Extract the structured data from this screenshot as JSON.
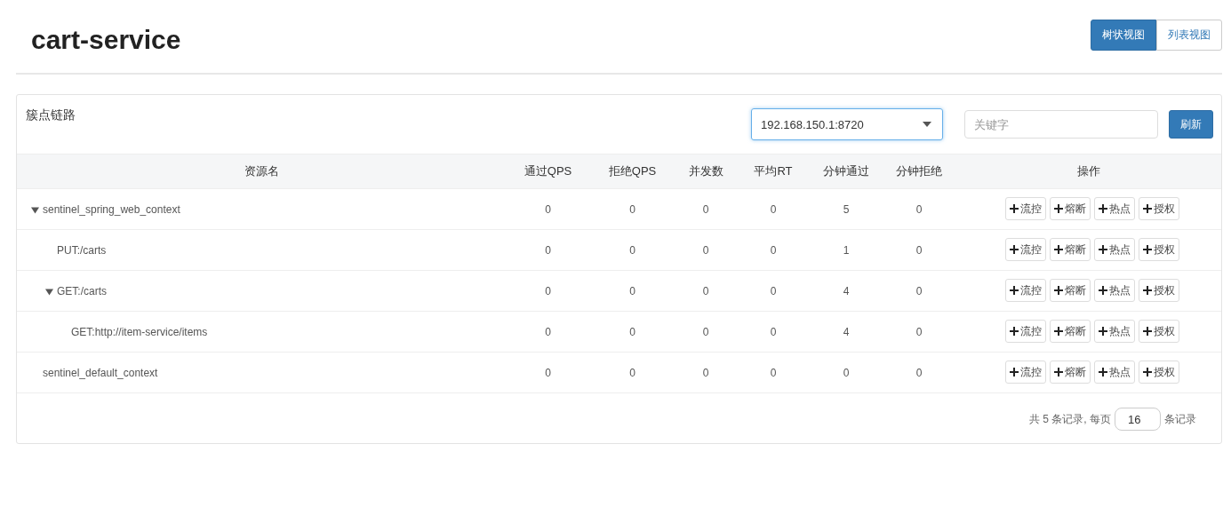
{
  "title": "cart-service",
  "view_toggle": [
    {
      "label": "树状视图",
      "selected": true
    },
    {
      "label": "列表视图",
      "selected": false
    }
  ],
  "panel": {
    "title": "簇点链路",
    "machine_select": {
      "value": "192.168.150.1:8720"
    },
    "search": {
      "placeholder": "关键字"
    },
    "refresh_button": "刷新"
  },
  "table": {
    "columns": [
      "资源名",
      "通过QPS",
      "拒绝QPS",
      "并发数",
      "平均RT",
      "分钟通过",
      "分钟拒绝",
      "操作"
    ],
    "rows": [
      {
        "name": "sentinel_spring_web_context",
        "expanded": true,
        "values": [
          "0",
          "0",
          "0",
          "0",
          "5",
          "0"
        ],
        "actions": [
          "流控",
          "熔断",
          "热点",
          "授权"
        ],
        "children": [
          {
            "name": "PUT:/carts",
            "values": [
              "0",
              "0",
              "0",
              "0",
              "1",
              "0"
            ],
            "actions": [
              "流控",
              "熔断",
              "热点",
              "授权"
            ]
          },
          {
            "name": "GET:/carts",
            "expanded": true,
            "values": [
              "0",
              "0",
              "0",
              "0",
              "4",
              "0"
            ],
            "actions": [
              "流控",
              "熔断",
              "热点",
              "授权"
            ],
            "children": [
              {
                "name": "GET:http://item-service/items",
                "values": [
                  "0",
                  "0",
                  "0",
                  "0",
                  "4",
                  "0"
                ],
                "actions": [
                  "流控",
                  "熔断",
                  "热点",
                  "授权"
                ]
              }
            ]
          }
        ]
      },
      {
        "name": "sentinel_default_context",
        "values": [
          "0",
          "0",
          "0",
          "0",
          "0",
          "0"
        ],
        "actions": [
          "流控",
          "熔断",
          "热点",
          "授权"
        ]
      }
    ]
  },
  "pagination": {
    "prefix": "共 5 条记录, 每页",
    "page_size": "16",
    "suffix": "条记录"
  }
}
